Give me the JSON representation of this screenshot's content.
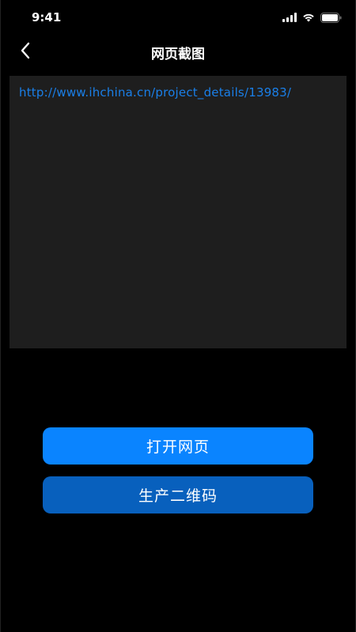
{
  "status_bar": {
    "time": "9:41",
    "icons": [
      "signal-icon",
      "wifi-icon",
      "battery-icon"
    ]
  },
  "nav": {
    "title": "网页截图",
    "back_icon": "chevron-left-icon"
  },
  "url_area": {
    "value": "http://www.ihchina.cn/project_details/13983/"
  },
  "buttons": {
    "open_label": "打开网页",
    "qr_label": "生产二维码"
  },
  "colors": {
    "background": "#000000",
    "text_area": "#1e1e1e",
    "link": "#1a7fe8",
    "primary_button": "#0a84ff",
    "secondary_button": "#0860bd"
  }
}
